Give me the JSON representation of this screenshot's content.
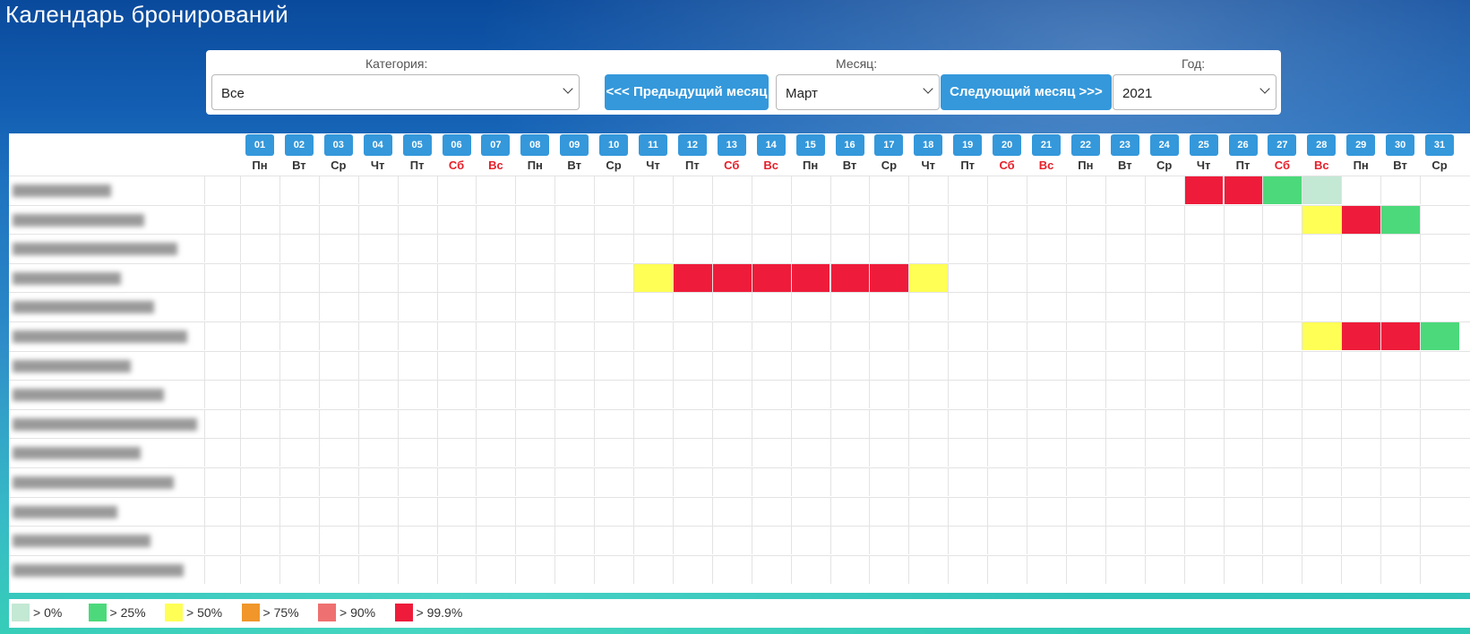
{
  "page_title": "Календарь бронирований",
  "filters": {
    "category_label": "Категория:",
    "category_value": "Все",
    "month_label": "Месяц:",
    "month_value": "Март",
    "year_label": "Год:",
    "year_value": "2021",
    "prev_month_label": "<<< Предыдущий месяц",
    "next_month_label": "Следующий месяц >>>"
  },
  "days": [
    {
      "num": "01",
      "wd": "Пн",
      "weekend": false
    },
    {
      "num": "02",
      "wd": "Вт",
      "weekend": false
    },
    {
      "num": "03",
      "wd": "Ср",
      "weekend": false
    },
    {
      "num": "04",
      "wd": "Чт",
      "weekend": false
    },
    {
      "num": "05",
      "wd": "Пт",
      "weekend": false
    },
    {
      "num": "06",
      "wd": "Сб",
      "weekend": true
    },
    {
      "num": "07",
      "wd": "Вс",
      "weekend": true
    },
    {
      "num": "08",
      "wd": "Пн",
      "weekend": false
    },
    {
      "num": "09",
      "wd": "Вт",
      "weekend": false
    },
    {
      "num": "10",
      "wd": "Ср",
      "weekend": false
    },
    {
      "num": "11",
      "wd": "Чт",
      "weekend": false
    },
    {
      "num": "12",
      "wd": "Пт",
      "weekend": false
    },
    {
      "num": "13",
      "wd": "Сб",
      "weekend": true
    },
    {
      "num": "14",
      "wd": "Вс",
      "weekend": true
    },
    {
      "num": "15",
      "wd": "Пн",
      "weekend": false
    },
    {
      "num": "16",
      "wd": "Вт",
      "weekend": false
    },
    {
      "num": "17",
      "wd": "Ср",
      "weekend": false
    },
    {
      "num": "18",
      "wd": "Чт",
      "weekend": false
    },
    {
      "num": "19",
      "wd": "Пт",
      "weekend": false
    },
    {
      "num": "20",
      "wd": "Сб",
      "weekend": true
    },
    {
      "num": "21",
      "wd": "Вс",
      "weekend": true
    },
    {
      "num": "22",
      "wd": "Пн",
      "weekend": false
    },
    {
      "num": "23",
      "wd": "Вт",
      "weekend": false
    },
    {
      "num": "24",
      "wd": "Ср",
      "weekend": false
    },
    {
      "num": "25",
      "wd": "Чт",
      "weekend": false
    },
    {
      "num": "26",
      "wd": "Пт",
      "weekend": false
    },
    {
      "num": "27",
      "wd": "Сб",
      "weekend": true
    },
    {
      "num": "28",
      "wd": "Вс",
      "weekend": true
    },
    {
      "num": "29",
      "wd": "Пн",
      "weekend": false
    },
    {
      "num": "30",
      "wd": "Вт",
      "weekend": false
    },
    {
      "num": "31",
      "wd": "Ср",
      "weekend": false
    }
  ],
  "occupancy_colors": {
    "gt0": "#c3e8d4",
    "gt25": "#4cd97b",
    "gt50": "#ffff55",
    "gt75": "#f0962a",
    "gt90": "#ef7070",
    "gt99_9": "#ee1c3a"
  },
  "rows": [
    {
      "bookings": {
        "25": "gt99_9",
        "26": "gt99_9",
        "27": "gt25",
        "28": "gt0"
      }
    },
    {
      "bookings": {
        "28": "gt50",
        "29": "gt99_9",
        "30": "gt25"
      }
    },
    {
      "bookings": {}
    },
    {
      "bookings": {
        "11": "gt50",
        "12": "gt99_9",
        "13": "gt99_9",
        "14": "gt99_9",
        "15": "gt99_9",
        "16": "gt99_9",
        "17": "gt99_9",
        "18": "gt50"
      }
    },
    {
      "bookings": {}
    },
    {
      "bookings": {
        "28": "gt50",
        "29": "gt99_9",
        "30": "gt99_9",
        "31": "gt25"
      }
    },
    {
      "bookings": {}
    },
    {
      "bookings": {}
    },
    {
      "bookings": {}
    },
    {
      "bookings": {}
    },
    {
      "bookings": {}
    },
    {
      "bookings": {}
    },
    {
      "bookings": {}
    },
    {
      "bookings": {}
    }
  ],
  "legend": [
    {
      "label": "> 0%",
      "color": "#c3e8d4"
    },
    {
      "label": "> 25%",
      "color": "#4cd97b"
    },
    {
      "label": "> 50%",
      "color": "#ffff55"
    },
    {
      "label": "> 75%",
      "color": "#f0962a"
    },
    {
      "label": "> 90%",
      "color": "#ef7070"
    },
    {
      "label": "> 99.9%",
      "color": "#ee1c3a"
    }
  ]
}
